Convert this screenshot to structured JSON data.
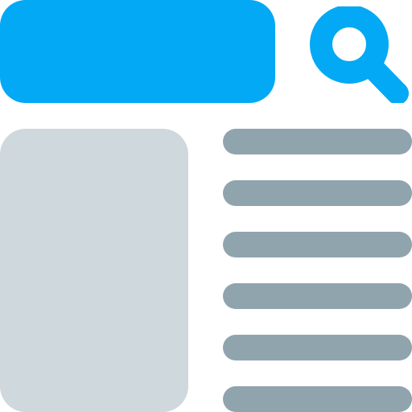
{
  "icon": "search-results-page-icon",
  "colors": {
    "accent": "#03A9F4",
    "placeholder": "#CFD8DC",
    "text_line": "#90A4AE",
    "background": "#FFFFFF"
  },
  "search_bar": {
    "icon": "search-bar-shape",
    "value": ""
  },
  "search_button": {
    "icon": "magnifier-icon"
  },
  "image_card": {
    "icon": "image-placeholder"
  },
  "text_lines": {
    "count": 6,
    "icon": "text-line"
  }
}
